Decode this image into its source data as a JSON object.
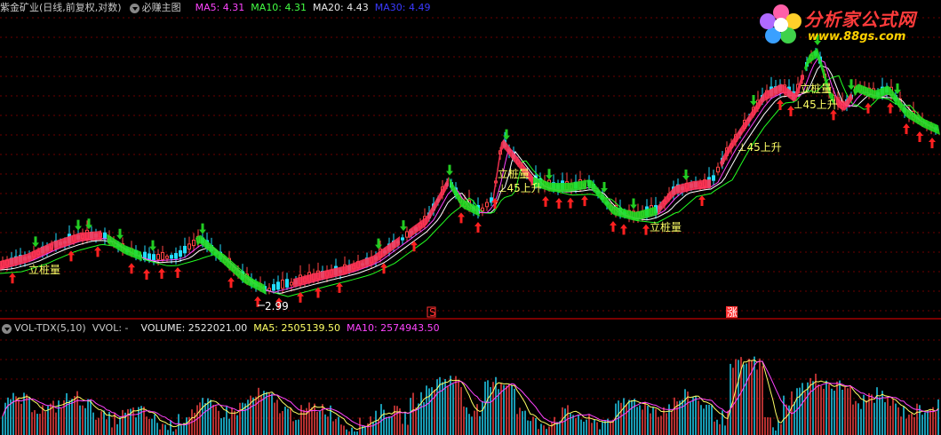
{
  "main_header": {
    "title": "紫金矿业(日线,前复权,对数)",
    "indicator": "必赚主图",
    "ma5": "MA5: 4.31",
    "ma10": "MA10: 4.31",
    "ma20": "MA20: 4.43",
    "ma30": "MA30: 4.49"
  },
  "vol_header": {
    "name": "VOL-TDX(5,10)",
    "vvol": "VVOL: -",
    "volume": "VOLUME: 2522021.00",
    "ma5": "MA5: 2505139.50",
    "ma10": "MA10: 2574943.50"
  },
  "logo": {
    "title": "分析家公式网",
    "url": "www.88gs.com"
  },
  "annotations": {
    "label_1": "立桩量",
    "label_2": "立桩量",
    "label_3": "立桩量",
    "label_4": "立桩量",
    "label_5": "45上升",
    "label_6": "45上升",
    "label_7": "45上升",
    "low_value": "2.99",
    "marker_s": "S",
    "marker_zhang": "涨"
  },
  "colors": {
    "ma5": "#ff00ff",
    "ma10": "#00ff00",
    "ma20": "#ffffff",
    "ma30": "#3030ff",
    "up_ribbon": "#ff3355",
    "down_ribbon": "#22dd22",
    "up_arrow": "#ff2020",
    "down_arrow": "#22cc22",
    "label": "#ffff66"
  }
}
